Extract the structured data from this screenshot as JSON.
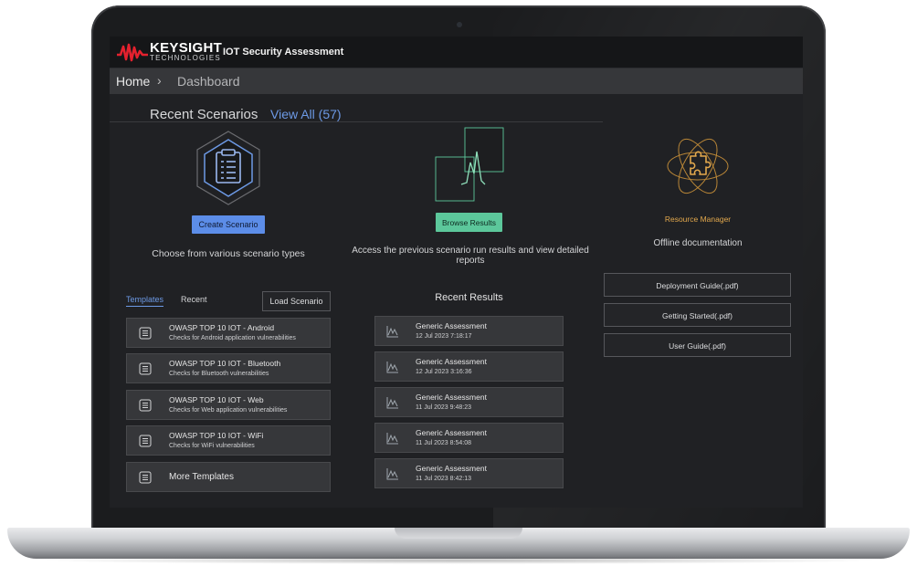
{
  "app": {
    "brand": "KEYSIGHT",
    "brand_sub": "TECHNOLOGIES",
    "title": "IOT Security Assessment",
    "brand_color": "#e4212e"
  },
  "breadcrumb": {
    "home": "Home",
    "separator": "›",
    "current": "Dashboard"
  },
  "recent_scenarios": {
    "title": "Recent Scenarios",
    "view_all": "View All (57)"
  },
  "create": {
    "button": "Create Scenario",
    "description": "Choose from various scenario types",
    "icon": "clipboard-hexagon-icon"
  },
  "browse": {
    "button": "Browse Results",
    "description": "Access the previous scenario run results and view detailed reports",
    "icon": "results-chart-icon"
  },
  "resources": {
    "link": "Resource Manager",
    "subtitle": "Offline documentation",
    "icon": "puzzle-atom-icon",
    "docs": [
      "Deployment Guide(.pdf)",
      "Getting Started(.pdf)",
      "User Guide(.pdf)"
    ]
  },
  "templates_panel": {
    "tabs": [
      "Templates",
      "Recent"
    ],
    "active_tab": "Templates",
    "load_button": "Load Scenario",
    "items": [
      {
        "title": "OWASP TOP 10 IOT - Android",
        "subtitle": "Checks for Android application vulnerabilities"
      },
      {
        "title": "OWASP TOP 10 IOT - Bluetooth",
        "subtitle": "Checks for Bluetooth vulnerabilities"
      },
      {
        "title": "OWASP TOP 10 IOT - Web",
        "subtitle": "Checks for Web application vulnerabilities"
      },
      {
        "title": "OWASP TOP 10 IOT - WiFi",
        "subtitle": "Checks for WiFi vulnerabilities"
      }
    ],
    "more": "More Templates"
  },
  "recent_results": {
    "title": "Recent Results",
    "items": [
      {
        "name": "Generic Assessment",
        "date": "12 Jul 2023 7:18:17"
      },
      {
        "name": "Generic Assessment",
        "date": "12 Jul 2023 3:16:36"
      },
      {
        "name": "Generic Assessment",
        "date": "11 Jul 2023 9:48:23"
      },
      {
        "name": "Generic Assessment",
        "date": "11 Jul 2023 8:54:08"
      },
      {
        "name": "Generic Assessment",
        "date": "11 Jul 2023 8:42:13"
      }
    ]
  },
  "colors": {
    "accent_blue": "#5c8de8",
    "accent_green": "#5cc79b",
    "accent_gold": "#e2a84d",
    "link_blue": "#6d9ae6"
  }
}
